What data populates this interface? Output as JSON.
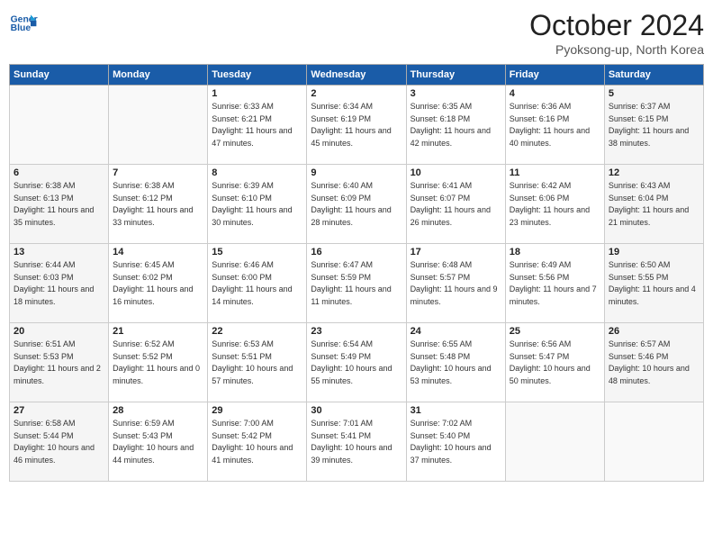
{
  "header": {
    "logo_line1": "General",
    "logo_line2": "Blue",
    "month_title": "October 2024",
    "location": "Pyoksong-up, North Korea"
  },
  "days_of_week": [
    "Sunday",
    "Monday",
    "Tuesday",
    "Wednesday",
    "Thursday",
    "Friday",
    "Saturday"
  ],
  "weeks": [
    [
      {
        "day": "",
        "sunrise": "",
        "sunset": "",
        "daylight": ""
      },
      {
        "day": "",
        "sunrise": "",
        "sunset": "",
        "daylight": ""
      },
      {
        "day": "1",
        "sunrise": "Sunrise: 6:33 AM",
        "sunset": "Sunset: 6:21 PM",
        "daylight": "Daylight: 11 hours and 47 minutes."
      },
      {
        "day": "2",
        "sunrise": "Sunrise: 6:34 AM",
        "sunset": "Sunset: 6:19 PM",
        "daylight": "Daylight: 11 hours and 45 minutes."
      },
      {
        "day": "3",
        "sunrise": "Sunrise: 6:35 AM",
        "sunset": "Sunset: 6:18 PM",
        "daylight": "Daylight: 11 hours and 42 minutes."
      },
      {
        "day": "4",
        "sunrise": "Sunrise: 6:36 AM",
        "sunset": "Sunset: 6:16 PM",
        "daylight": "Daylight: 11 hours and 40 minutes."
      },
      {
        "day": "5",
        "sunrise": "Sunrise: 6:37 AM",
        "sunset": "Sunset: 6:15 PM",
        "daylight": "Daylight: 11 hours and 38 minutes."
      }
    ],
    [
      {
        "day": "6",
        "sunrise": "Sunrise: 6:38 AM",
        "sunset": "Sunset: 6:13 PM",
        "daylight": "Daylight: 11 hours and 35 minutes."
      },
      {
        "day": "7",
        "sunrise": "Sunrise: 6:38 AM",
        "sunset": "Sunset: 6:12 PM",
        "daylight": "Daylight: 11 hours and 33 minutes."
      },
      {
        "day": "8",
        "sunrise": "Sunrise: 6:39 AM",
        "sunset": "Sunset: 6:10 PM",
        "daylight": "Daylight: 11 hours and 30 minutes."
      },
      {
        "day": "9",
        "sunrise": "Sunrise: 6:40 AM",
        "sunset": "Sunset: 6:09 PM",
        "daylight": "Daylight: 11 hours and 28 minutes."
      },
      {
        "day": "10",
        "sunrise": "Sunrise: 6:41 AM",
        "sunset": "Sunset: 6:07 PM",
        "daylight": "Daylight: 11 hours and 26 minutes."
      },
      {
        "day": "11",
        "sunrise": "Sunrise: 6:42 AM",
        "sunset": "Sunset: 6:06 PM",
        "daylight": "Daylight: 11 hours and 23 minutes."
      },
      {
        "day": "12",
        "sunrise": "Sunrise: 6:43 AM",
        "sunset": "Sunset: 6:04 PM",
        "daylight": "Daylight: 11 hours and 21 minutes."
      }
    ],
    [
      {
        "day": "13",
        "sunrise": "Sunrise: 6:44 AM",
        "sunset": "Sunset: 6:03 PM",
        "daylight": "Daylight: 11 hours and 18 minutes."
      },
      {
        "day": "14",
        "sunrise": "Sunrise: 6:45 AM",
        "sunset": "Sunset: 6:02 PM",
        "daylight": "Daylight: 11 hours and 16 minutes."
      },
      {
        "day": "15",
        "sunrise": "Sunrise: 6:46 AM",
        "sunset": "Sunset: 6:00 PM",
        "daylight": "Daylight: 11 hours and 14 minutes."
      },
      {
        "day": "16",
        "sunrise": "Sunrise: 6:47 AM",
        "sunset": "Sunset: 5:59 PM",
        "daylight": "Daylight: 11 hours and 11 minutes."
      },
      {
        "day": "17",
        "sunrise": "Sunrise: 6:48 AM",
        "sunset": "Sunset: 5:57 PM",
        "daylight": "Daylight: 11 hours and 9 minutes."
      },
      {
        "day": "18",
        "sunrise": "Sunrise: 6:49 AM",
        "sunset": "Sunset: 5:56 PM",
        "daylight": "Daylight: 11 hours and 7 minutes."
      },
      {
        "day": "19",
        "sunrise": "Sunrise: 6:50 AM",
        "sunset": "Sunset: 5:55 PM",
        "daylight": "Daylight: 11 hours and 4 minutes."
      }
    ],
    [
      {
        "day": "20",
        "sunrise": "Sunrise: 6:51 AM",
        "sunset": "Sunset: 5:53 PM",
        "daylight": "Daylight: 11 hours and 2 minutes."
      },
      {
        "day": "21",
        "sunrise": "Sunrise: 6:52 AM",
        "sunset": "Sunset: 5:52 PM",
        "daylight": "Daylight: 11 hours and 0 minutes."
      },
      {
        "day": "22",
        "sunrise": "Sunrise: 6:53 AM",
        "sunset": "Sunset: 5:51 PM",
        "daylight": "Daylight: 10 hours and 57 minutes."
      },
      {
        "day": "23",
        "sunrise": "Sunrise: 6:54 AM",
        "sunset": "Sunset: 5:49 PM",
        "daylight": "Daylight: 10 hours and 55 minutes."
      },
      {
        "day": "24",
        "sunrise": "Sunrise: 6:55 AM",
        "sunset": "Sunset: 5:48 PM",
        "daylight": "Daylight: 10 hours and 53 minutes."
      },
      {
        "day": "25",
        "sunrise": "Sunrise: 6:56 AM",
        "sunset": "Sunset: 5:47 PM",
        "daylight": "Daylight: 10 hours and 50 minutes."
      },
      {
        "day": "26",
        "sunrise": "Sunrise: 6:57 AM",
        "sunset": "Sunset: 5:46 PM",
        "daylight": "Daylight: 10 hours and 48 minutes."
      }
    ],
    [
      {
        "day": "27",
        "sunrise": "Sunrise: 6:58 AM",
        "sunset": "Sunset: 5:44 PM",
        "daylight": "Daylight: 10 hours and 46 minutes."
      },
      {
        "day": "28",
        "sunrise": "Sunrise: 6:59 AM",
        "sunset": "Sunset: 5:43 PM",
        "daylight": "Daylight: 10 hours and 44 minutes."
      },
      {
        "day": "29",
        "sunrise": "Sunrise: 7:00 AM",
        "sunset": "Sunset: 5:42 PM",
        "daylight": "Daylight: 10 hours and 41 minutes."
      },
      {
        "day": "30",
        "sunrise": "Sunrise: 7:01 AM",
        "sunset": "Sunset: 5:41 PM",
        "daylight": "Daylight: 10 hours and 39 minutes."
      },
      {
        "day": "31",
        "sunrise": "Sunrise: 7:02 AM",
        "sunset": "Sunset: 5:40 PM",
        "daylight": "Daylight: 10 hours and 37 minutes."
      },
      {
        "day": "",
        "sunrise": "",
        "sunset": "",
        "daylight": ""
      },
      {
        "day": "",
        "sunrise": "",
        "sunset": "",
        "daylight": ""
      }
    ]
  ]
}
